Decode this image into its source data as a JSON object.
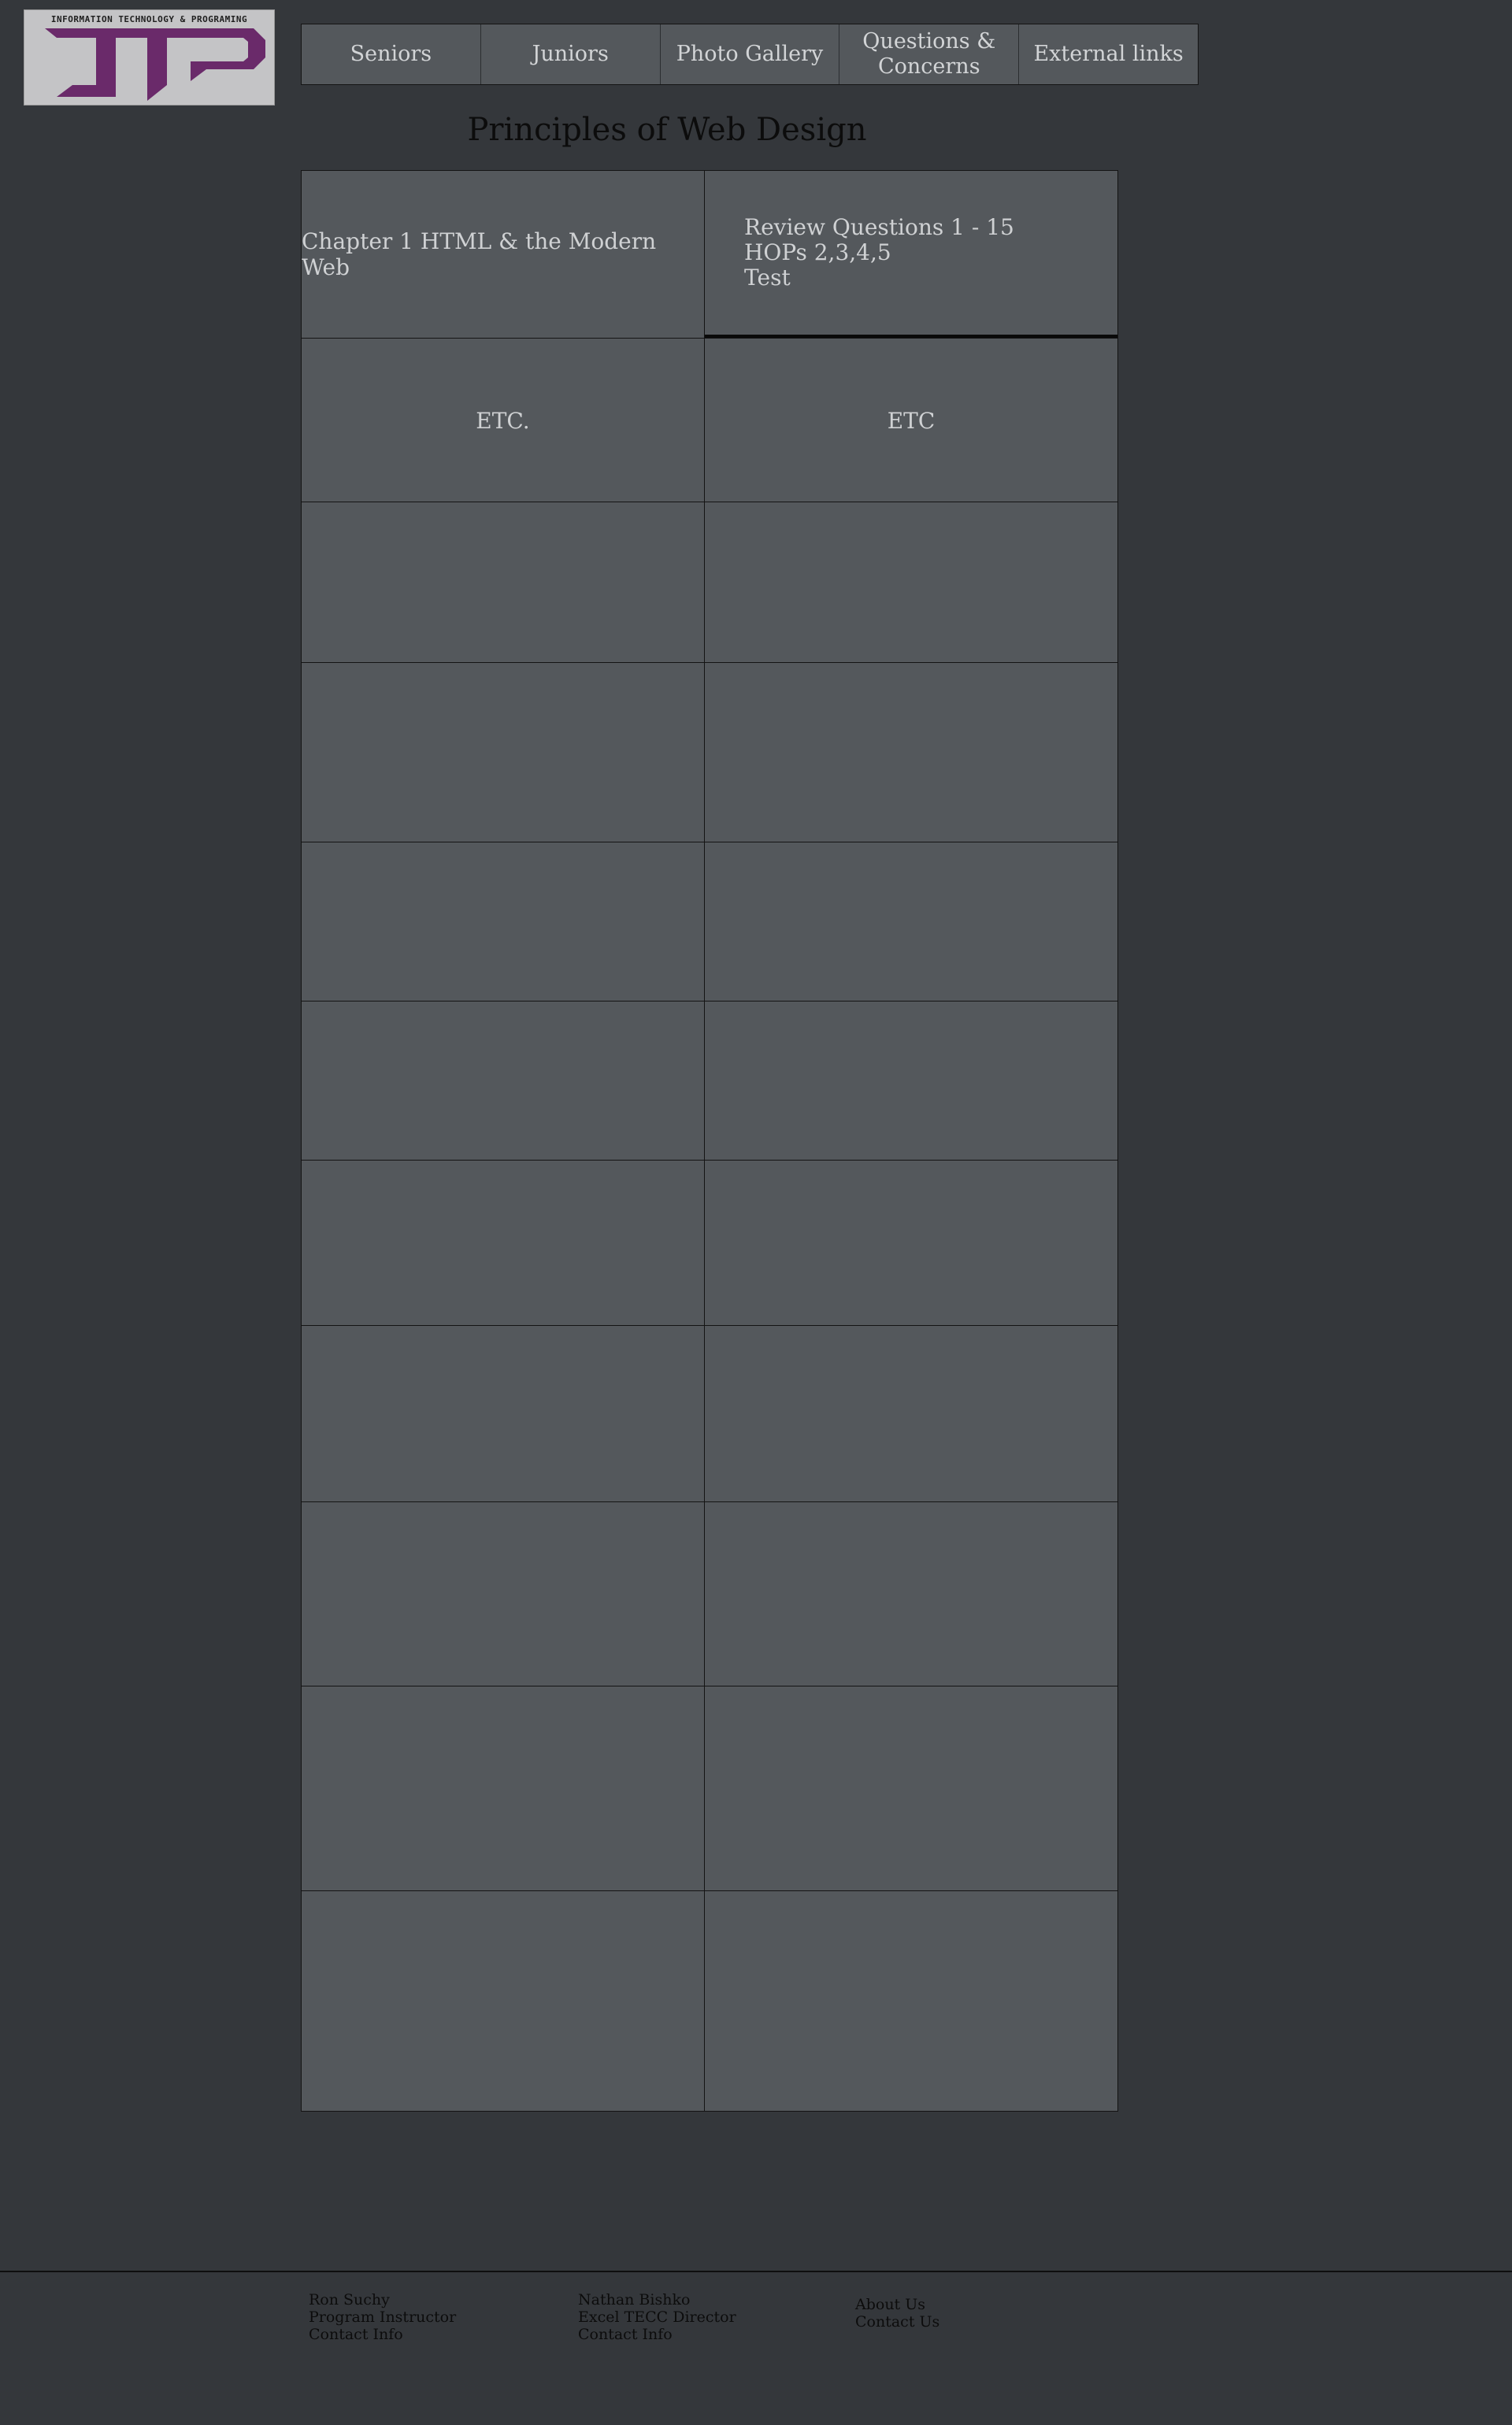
{
  "logo": {
    "tagline": "INFORMATION TECHNOLOGY & PROGRAMING",
    "text": "ITP",
    "color": "#6a2a6a"
  },
  "nav": {
    "items": [
      {
        "label": "Seniors"
      },
      {
        "label": "Juniors"
      },
      {
        "label": "Photo Gallery"
      },
      {
        "label": "Questions & Concerns"
      },
      {
        "label": "External links"
      }
    ]
  },
  "page_title": "Principles of Web Design",
  "table": {
    "rows": [
      {
        "left": "Chapter 1 HTML & the Modern Web",
        "right_lines": [
          "Review Questions 1 - 15",
          "HOPs 2,3,4,5",
          "Test"
        ]
      },
      {
        "left": "ETC.",
        "right": "ETC"
      },
      {
        "left": "",
        "right": ""
      },
      {
        "left": "",
        "right": ""
      },
      {
        "left": "",
        "right": ""
      },
      {
        "left": "",
        "right": ""
      },
      {
        "left": "",
        "right": ""
      },
      {
        "left": "",
        "right": ""
      },
      {
        "left": "",
        "right": ""
      },
      {
        "left": "",
        "right": ""
      },
      {
        "left": "",
        "right": ""
      }
    ]
  },
  "footer": {
    "col1": {
      "name": "Ron Suchy",
      "role": "Program Instructor",
      "contact": "Contact Info"
    },
    "col2": {
      "name": "Nathan Bishko",
      "role": "Excel TECC Director",
      "contact": "Contact Info"
    },
    "col3": {
      "about": "About Us",
      "contact": "Contact Us"
    }
  },
  "colors": {
    "background": "#34373b",
    "panel": "#54585c",
    "text_light": "#cfd1d3",
    "border": "#141414"
  }
}
